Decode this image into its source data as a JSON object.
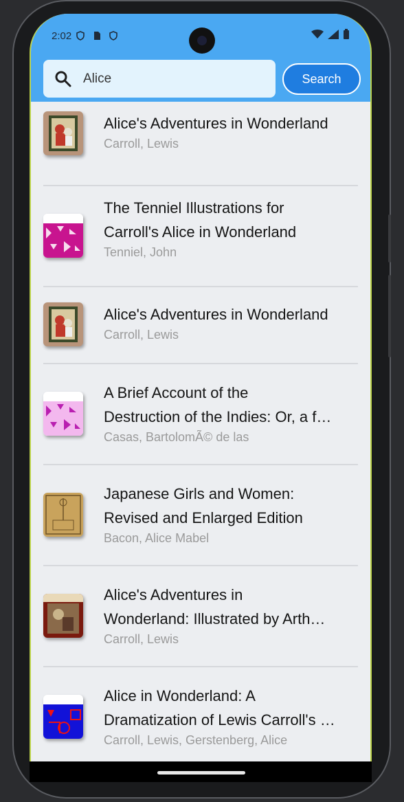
{
  "status_bar": {
    "time": "2:02",
    "icons": [
      "shield-icon",
      "sim-card-icon",
      "shield-icon"
    ],
    "right_icons": [
      "wifi-icon",
      "signal-icon",
      "battery-icon"
    ]
  },
  "search": {
    "value": "Alice",
    "button_label": "Search"
  },
  "results": [
    {
      "title": "Alice's Adventures in Wonderland",
      "author": "Carroll, Lewis",
      "cover": "illustrated-cover"
    },
    {
      "title_line1": "The Tenniel Illustrations for",
      "title_line2": "Carroll's Alice in Wonderland",
      "author": "Tenniel, John",
      "cover": "magenta-pattern-cover"
    },
    {
      "title": "Alice's Adventures in Wonderland",
      "author": "Carroll, Lewis",
      "cover": "illustrated-cover"
    },
    {
      "title_line1": "A Brief Account of the",
      "title_line2": "Destruction of the Indies: Or, a f…",
      "author": "Casas, BartolomÃ© de las",
      "cover": "pink-pattern-cover"
    },
    {
      "title_line1": "Japanese Girls and Women:",
      "title_line2": "Revised and Enlarged Edition",
      "author": "Bacon, Alice Mabel",
      "cover": "tan-vintage-cover"
    },
    {
      "title_line1": "Alice's Adventures in",
      "title_line2": "Wonderland: Illustrated by Arth…",
      "author": "Carroll, Lewis",
      "cover": "rackham-cover"
    },
    {
      "title_line1": "Alice in Wonderland: A",
      "title_line2": "Dramatization of Lewis Carroll's …",
      "author": "Carroll, Lewis, Gerstenberg, Alice",
      "cover": "blue-pattern-cover"
    }
  ],
  "colors": {
    "app_bar": "#4aa8f2",
    "search_button": "#1f7de0",
    "list_background": "#eceef1"
  }
}
